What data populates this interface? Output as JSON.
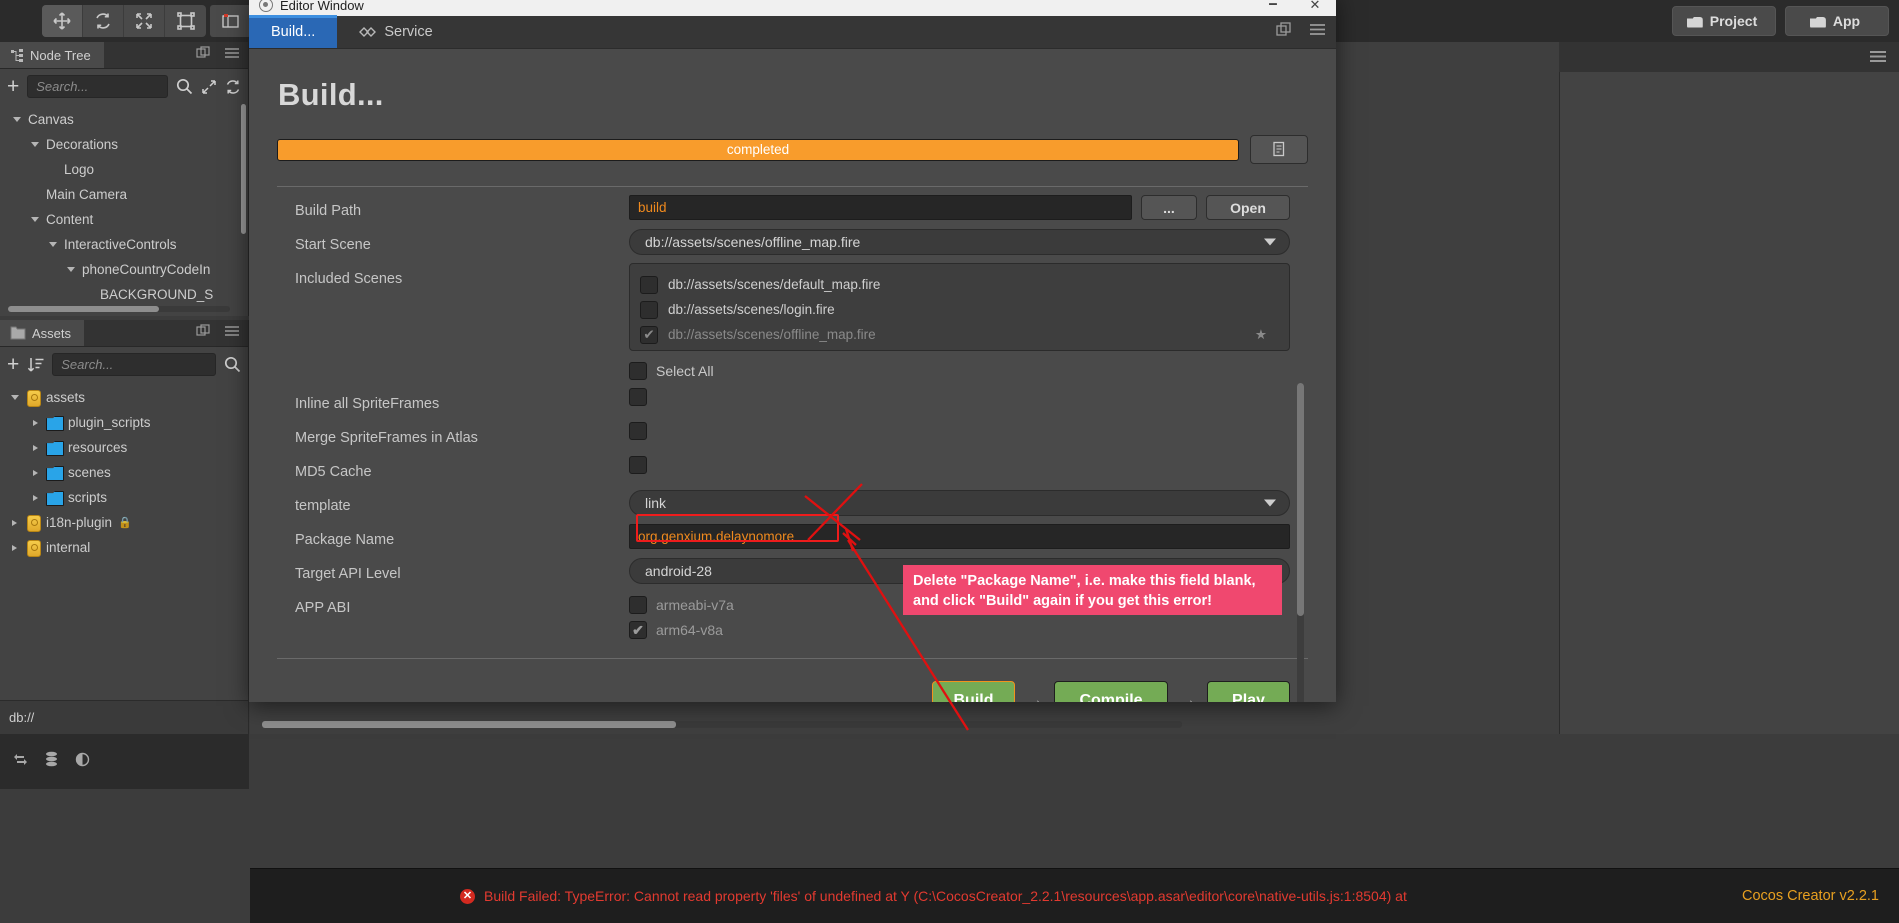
{
  "toolbar": {
    "tools": [
      {
        "name": "move-tool",
        "icon": "move-icon",
        "active": true
      },
      {
        "name": "rotate-tool",
        "icon": "rotate-icon",
        "active": false
      },
      {
        "name": "scale-tool",
        "icon": "scale-icon",
        "active": false
      },
      {
        "name": "rect-tool",
        "icon": "rect-transform-icon",
        "active": false
      }
    ],
    "extra_icon": "layout-icon",
    "project_button": "Project",
    "app_button": "App"
  },
  "node_tree": {
    "tab_label": "Node Tree",
    "search_placeholder": "Search...",
    "items": [
      {
        "label": "Canvas",
        "depth": 1,
        "expanded": true,
        "has_arrow": true
      },
      {
        "label": "Decorations",
        "depth": 2,
        "expanded": true,
        "has_arrow": true
      },
      {
        "label": "Logo",
        "depth": 3,
        "expanded": false,
        "has_arrow": false
      },
      {
        "label": "Main Camera",
        "depth": 2,
        "expanded": false,
        "has_arrow": false
      },
      {
        "label": "Content",
        "depth": 2,
        "expanded": true,
        "has_arrow": true
      },
      {
        "label": "InteractiveControls",
        "depth": 3,
        "expanded": true,
        "has_arrow": true
      },
      {
        "label": "phoneCountryCodeIn",
        "depth": 4,
        "expanded": true,
        "has_arrow": true
      },
      {
        "label": "BACKGROUND_S",
        "depth": 5,
        "expanded": false,
        "has_arrow": false
      }
    ]
  },
  "assets": {
    "tab_label": "Assets",
    "search_placeholder": "Search...",
    "items": [
      {
        "label": "assets",
        "depth": 1,
        "type": "db",
        "expanded": true,
        "has_arrow": true,
        "locked": false
      },
      {
        "label": "plugin_scripts",
        "depth": 2,
        "type": "folder",
        "expanded": false,
        "has_arrow": true,
        "locked": false
      },
      {
        "label": "resources",
        "depth": 2,
        "type": "folder",
        "expanded": false,
        "has_arrow": true,
        "locked": false
      },
      {
        "label": "scenes",
        "depth": 2,
        "type": "folder",
        "expanded": false,
        "has_arrow": true,
        "locked": false
      },
      {
        "label": "scripts",
        "depth": 2,
        "type": "folder",
        "expanded": false,
        "has_arrow": true,
        "locked": false
      },
      {
        "label": "i18n-plugin",
        "depth": 1,
        "type": "db",
        "expanded": false,
        "has_arrow": true,
        "locked": true
      },
      {
        "label": "internal",
        "depth": 1,
        "type": "db",
        "expanded": false,
        "has_arrow": true,
        "locked": false
      }
    ]
  },
  "db_bar": {
    "path": "db://"
  },
  "build_window": {
    "title": "Editor Window",
    "tabs": [
      {
        "label": "Build...",
        "icon": "",
        "active": true
      },
      {
        "label": "Service",
        "icon": "service-icon",
        "active": false
      }
    ],
    "heading": "Build...",
    "progress": {
      "text": "completed",
      "percent": 100
    },
    "fields": {
      "build_path": {
        "label": "Build Path",
        "value": "build",
        "browse_button": "...",
        "open_button": "Open"
      },
      "start_scene": {
        "label": "Start Scene",
        "value": "db://assets/scenes/offline_map.fire"
      },
      "included_scenes": {
        "label": "Included Scenes",
        "items": [
          {
            "path": "db://assets/scenes/default_map.fire",
            "checked": false,
            "dim": false,
            "starred": false
          },
          {
            "path": "db://assets/scenes/login.fire",
            "checked": false,
            "dim": false,
            "starred": false
          },
          {
            "path": "db://assets/scenes/offline_map.fire",
            "checked": true,
            "dim": true,
            "starred": true
          }
        ],
        "select_all_label": "Select All",
        "select_all_checked": false
      },
      "inline_spriteframes": {
        "label": "Inline all SpriteFrames",
        "checked": false
      },
      "merge_spriteframes": {
        "label": "Merge SpriteFrames in Atlas",
        "checked": false
      },
      "md5_cache": {
        "label": "MD5 Cache",
        "checked": false
      },
      "template": {
        "label": "template",
        "value": "link"
      },
      "package_name": {
        "label": "Package Name",
        "value": "org.genxium.delaynomore"
      },
      "target_api_level": {
        "label": "Target API Level",
        "value": "android-28"
      },
      "app_abi": {
        "label": "APP ABI",
        "options": [
          {
            "label": "armeabi-v7a",
            "checked": false
          },
          {
            "label": "arm64-v8a",
            "checked": true
          }
        ]
      }
    },
    "footer": {
      "build_button": "Build",
      "compile_button": "Compile",
      "play_button": "Play",
      "separator": "→"
    }
  },
  "annotation": {
    "callout_line1": "Delete \"Package Name\", i.e. make this field blank,",
    "callout_line2": "and click \"Build\" again if you get this error!",
    "highlight_color": "#ef1c1c",
    "callout_bg": "#f0486f"
  },
  "status_bar": {
    "error_text": "Build Failed: TypeError: Cannot read property 'files' of undefined at Y (C:\\CocosCreator_2.2.1\\resources\\app.asar\\editor\\core\\native-utils.js:1:8504) at",
    "error_color": "#e23a30",
    "version": "Cocos Creator v2.2.1",
    "version_color": "#e8a020"
  }
}
